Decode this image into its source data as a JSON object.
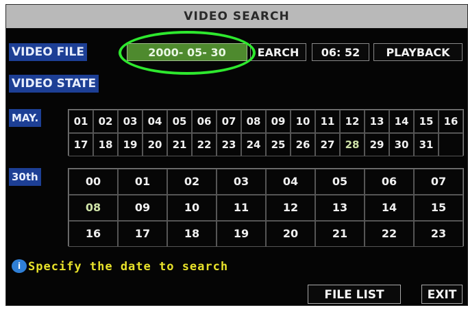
{
  "title": "VIDEO SEARCH",
  "video_file": {
    "label": "VIDEO FILE",
    "date": "2000- 05- 30",
    "search_label": "EARCH",
    "time": "06: 52",
    "playback_label": "PLAYBACK"
  },
  "video_state_label": "VIDEO STATE",
  "month_label": "MAY.",
  "days": [
    "01",
    "02",
    "03",
    "04",
    "05",
    "06",
    "07",
    "08",
    "09",
    "10",
    "11",
    "12",
    "13",
    "14",
    "15",
    "16",
    "17",
    "18",
    "19",
    "20",
    "21",
    "22",
    "23",
    "24",
    "25",
    "26",
    "27",
    "28",
    "29",
    "30",
    "31",
    ""
  ],
  "day_label": "30th",
  "hours": [
    "00",
    "01",
    "02",
    "03",
    "04",
    "05",
    "06",
    "07",
    "08",
    "09",
    "10",
    "11",
    "12",
    "13",
    "14",
    "15",
    "16",
    "17",
    "18",
    "19",
    "20",
    "21",
    "22",
    "23"
  ],
  "hint": {
    "icon": "info-bubble-icon",
    "text": "Specify the date to search"
  },
  "buttons": {
    "file_list": "FILE LIST",
    "exit": "EXIT"
  },
  "colors": {
    "highlight_ring": "#2ee82e",
    "date_field": "#4e8a2e",
    "label_bg": "#1d3f95",
    "hint_text": "#e8e22a"
  }
}
